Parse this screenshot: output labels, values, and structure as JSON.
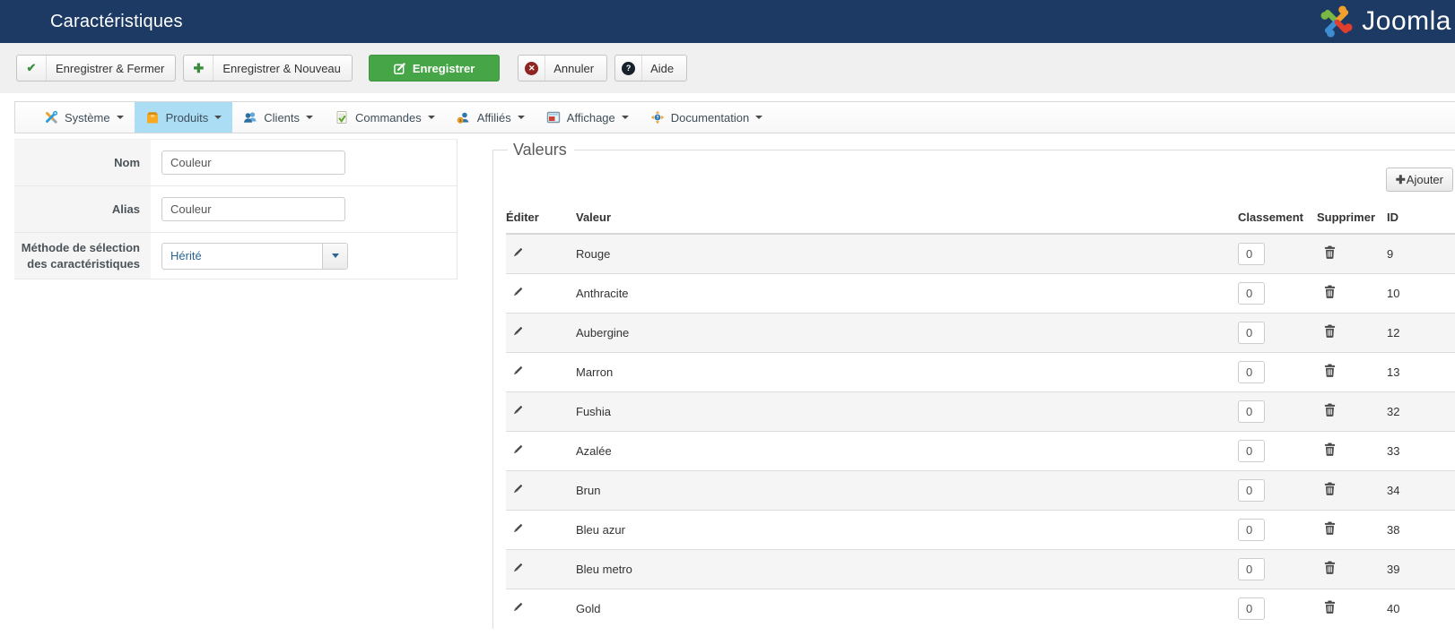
{
  "navbar": {
    "title": "Caractéristiques",
    "logo_text": "Joomla"
  },
  "toolbar": {
    "buttons": [
      {
        "label": "Enregistrer & Fermer",
        "icon": "check-icon"
      },
      {
        "label": "Enregistrer & Nouveau",
        "icon": "plus-icon"
      },
      {
        "label": "Enregistrer",
        "icon": "edit-square-icon",
        "primary": true
      },
      {
        "label": "Annuler",
        "icon": "cancel-icon"
      },
      {
        "label": "Aide",
        "icon": "help-icon"
      }
    ]
  },
  "icons": {
    "check": "✔",
    "plus": "✚",
    "cancel_x": "✕",
    "help_q": "?",
    "add_plus": "✚"
  },
  "menubar": {
    "items": [
      {
        "label": "Système",
        "icon": "tools-icon",
        "active": false
      },
      {
        "label": "Produits",
        "icon": "package-icon",
        "active": true
      },
      {
        "label": "Clients",
        "icon": "users-icon",
        "active": false
      },
      {
        "label": "Commandes",
        "icon": "order-sheet-icon",
        "active": false
      },
      {
        "label": "Affiliés",
        "icon": "affiliate-icon",
        "active": false
      },
      {
        "label": "Affichage",
        "icon": "display-icon",
        "active": false
      },
      {
        "label": "Documentation",
        "icon": "documentation-icon",
        "active": false
      }
    ]
  },
  "form": {
    "fields": [
      {
        "label": "Nom",
        "value": "Couleur",
        "type": "text"
      },
      {
        "label": "Alias",
        "value": "Couleur",
        "type": "text"
      },
      {
        "label": "Méthode de sélection des caractéristiques",
        "value": "Hérité",
        "type": "select"
      }
    ]
  },
  "values_panel": {
    "legend": "Valeurs",
    "add_button_label": "Ajouter",
    "table": {
      "headers": [
        "Éditer",
        "Valeur",
        "Classement",
        "Supprimer",
        "ID"
      ],
      "rows": [
        {
          "value": "Rouge",
          "ordering": "0",
          "id": "9"
        },
        {
          "value": "Anthracite",
          "ordering": "0",
          "id": "10"
        },
        {
          "value": "Aubergine",
          "ordering": "0",
          "id": "12"
        },
        {
          "value": "Marron",
          "ordering": "0",
          "id": "13"
        },
        {
          "value": "Fushia",
          "ordering": "0",
          "id": "32"
        },
        {
          "value": "Azalée",
          "ordering": "0",
          "id": "33"
        },
        {
          "value": "Brun",
          "ordering": "0",
          "id": "34"
        },
        {
          "value": "Bleu azur",
          "ordering": "0",
          "id": "38"
        },
        {
          "value": "Bleu metro",
          "ordering": "0",
          "id": "39"
        },
        {
          "value": "Gold",
          "ordering": "0",
          "id": "40"
        }
      ]
    }
  },
  "colors": {
    "navbar_bg": "#1c3a63",
    "primary_green": "#46a546",
    "active_menu_bg": "#abddf5",
    "link_blue": "#2a6496",
    "row_stripe": "#f5f5f5"
  }
}
